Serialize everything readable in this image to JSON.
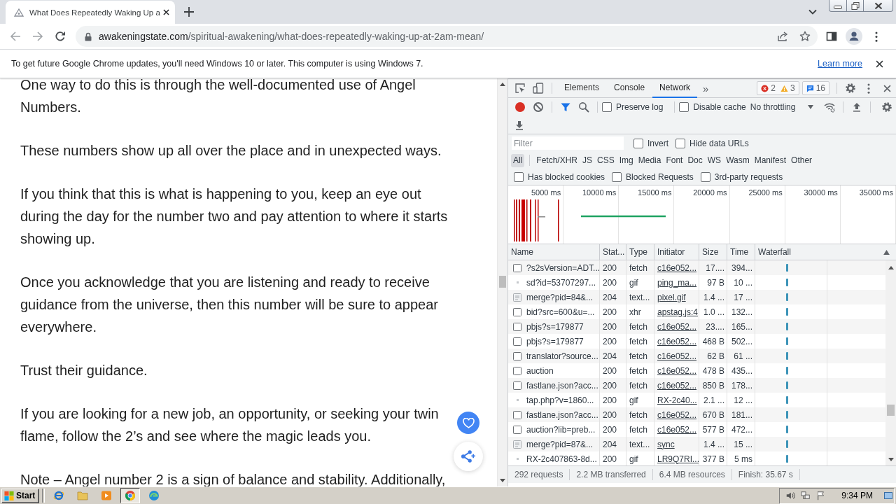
{
  "browser": {
    "tab": {
      "title": "What Does Repeatedly Waking Up a",
      "selected": true
    },
    "address": {
      "host": "awakeningstate.com",
      "path": "/spiritual-awakening/what-does-repeatedly-waking-up-at-2am-mean/"
    }
  },
  "infobar": {
    "message": "To get future Google Chrome updates, you'll need Windows 10 or later. This computer is using Windows 7.",
    "link": "Learn more"
  },
  "article": {
    "paragraphs": [
      "One way to do this is through the well-documented use of Angel Numbers.",
      "These numbers show up all over the place and in unexpected ways.",
      "If you think that this is what is happening to you, keep an eye out during the day for the number two and pay attention to where it starts showing up.",
      "Once you acknowledge that you are listening and ready to receive guidance from the universe, then this number will be sure to appear everywhere.",
      "Trust their guidance.",
      "If you are looking for a new job, an opportunity, or seeking your twin flame, follow the 2’s and see where the magic leads you.",
      "Note – Angel number 2 is a sign of balance and stability. Additionally,"
    ]
  },
  "devtools": {
    "tabs": [
      {
        "label": "Elements",
        "selected": false
      },
      {
        "label": "Console",
        "selected": false
      },
      {
        "label": "Network",
        "selected": true
      }
    ],
    "more_tabs": "»",
    "issues": {
      "errors": "2",
      "warnings": "3",
      "messages": "16"
    },
    "recording": true,
    "toolbar_checks": [
      {
        "label": "Preserve log",
        "checked": false
      },
      {
        "label": "Disable cache",
        "checked": false
      }
    ],
    "throttling": "No throttling",
    "filter": {
      "placeholder": "Filter"
    },
    "filter_checks": [
      {
        "label": "Invert",
        "checked": false
      },
      {
        "label": "Hide data URLs",
        "checked": false
      }
    ],
    "type_filters": [
      {
        "label": "All",
        "selected": true
      },
      {
        "label": "Fetch/XHR",
        "selected": false
      },
      {
        "label": "JS",
        "selected": false
      },
      {
        "label": "CSS",
        "selected": false
      },
      {
        "label": "Img",
        "selected": false
      },
      {
        "label": "Media",
        "selected": false
      },
      {
        "label": "Font",
        "selected": false
      },
      {
        "label": "Doc",
        "selected": false
      },
      {
        "label": "WS",
        "selected": false
      },
      {
        "label": "Wasm",
        "selected": false
      },
      {
        "label": "Manifest",
        "selected": false
      },
      {
        "label": "Other",
        "selected": false
      }
    ],
    "request_checks": [
      {
        "label": "Has blocked cookies",
        "checked": false
      },
      {
        "label": "Blocked Requests",
        "checked": false
      },
      {
        "label": "3rd-party requests",
        "checked": false
      }
    ],
    "overview_ticks": [
      "5000 ms",
      "10000 ms",
      "15000 ms",
      "20000 ms",
      "25000 ms",
      "30000 ms",
      "35000 ms"
    ],
    "table": {
      "columns": [
        "Name",
        "Stat...",
        "Type",
        "Initiator",
        "Size",
        "Time",
        "Waterfall"
      ],
      "rows": [
        {
          "kind": "document",
          "name": "?s2sVersion=ADT...",
          "status": "200",
          "type": "fetch",
          "initiator": "c16e052...",
          "size": "17....",
          "time": "394..."
        },
        {
          "kind": "image",
          "name": "sd?id=53707297...",
          "status": "200",
          "type": "gif",
          "initiator": "ping_ma...",
          "size": "97 B",
          "time": "10 ..."
        },
        {
          "kind": "text",
          "name": "merge?pid=84&...",
          "status": "204",
          "type": "text...",
          "initiator": "pixel.gif",
          "size": "1.4 ...",
          "time": "17 ..."
        },
        {
          "kind": "document",
          "name": "bid?src=600&u=...",
          "status": "200",
          "type": "xhr",
          "initiator": "apstag.js:4",
          "size": "1.0 ...",
          "time": "132..."
        },
        {
          "kind": "document",
          "name": "pbjs?s=179877",
          "status": "200",
          "type": "fetch",
          "initiator": "c16e052...",
          "size": "23....",
          "time": "165..."
        },
        {
          "kind": "document",
          "name": "pbjs?s=179877",
          "status": "200",
          "type": "fetch",
          "initiator": "c16e052...",
          "size": "468 B",
          "time": "502..."
        },
        {
          "kind": "document",
          "name": "translator?source...",
          "status": "204",
          "type": "fetch",
          "initiator": "c16e052...",
          "size": "62 B",
          "time": "61 ..."
        },
        {
          "kind": "document",
          "name": "auction",
          "status": "200",
          "type": "fetch",
          "initiator": "c16e052...",
          "size": "478 B",
          "time": "435..."
        },
        {
          "kind": "document",
          "name": "fastlane.json?acc...",
          "status": "200",
          "type": "fetch",
          "initiator": "c16e052...",
          "size": "850 B",
          "time": "178..."
        },
        {
          "kind": "image",
          "name": "tap.php?v=1860...",
          "status": "200",
          "type": "gif",
          "initiator": "RX-2c40...",
          "size": "2.1 ...",
          "time": "12 ..."
        },
        {
          "kind": "document",
          "name": "fastlane.json?acc...",
          "status": "200",
          "type": "fetch",
          "initiator": "c16e052...",
          "size": "670 B",
          "time": "181..."
        },
        {
          "kind": "document",
          "name": "auction?lib=preb...",
          "status": "200",
          "type": "fetch",
          "initiator": "c16e052...",
          "size": "577 B",
          "time": "472..."
        },
        {
          "kind": "text",
          "name": "merge?pid=87&...",
          "status": "204",
          "type": "text...",
          "initiator": "sync",
          "size": "1.4 ...",
          "time": "15 ..."
        },
        {
          "kind": "image",
          "name": "RX-2c407863-8d...",
          "status": "200",
          "type": "gif",
          "initiator": "LR9Q7RI...",
          "size": "377 B",
          "time": "5 ms"
        }
      ]
    },
    "status_bar": [
      "292 requests",
      "2.2 MB transferred",
      "6.4 MB resources",
      "Finish: 35.67 s"
    ]
  },
  "taskbar": {
    "start": "Start",
    "apps": [
      {
        "kind": "explorer",
        "selected": false
      },
      {
        "kind": "folder",
        "selected": false
      },
      {
        "kind": "player",
        "selected": false
      },
      {
        "kind": "chrome",
        "selected": true
      },
      {
        "kind": "edge",
        "selected": false
      }
    ],
    "clock": "9:34 PM"
  }
}
